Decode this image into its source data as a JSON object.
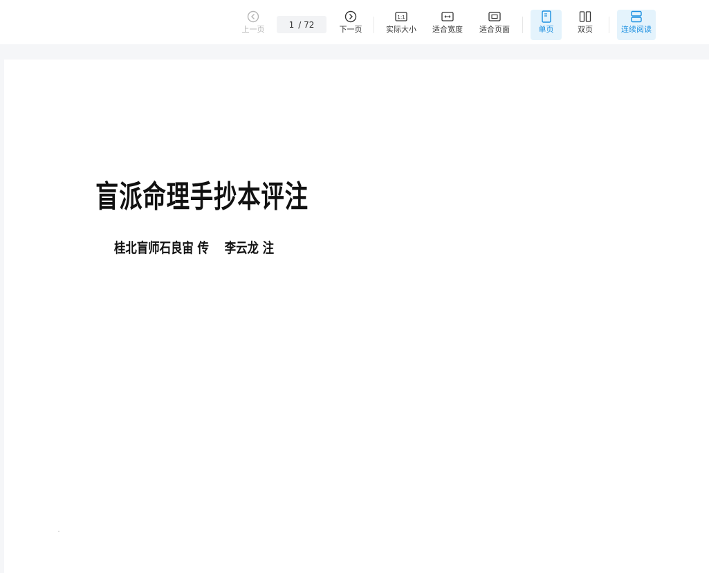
{
  "toolbar": {
    "prev_label": "上一页",
    "current_page": "1",
    "total_pages": "/ 72",
    "next_label": "下一页",
    "actual_size_label": "实际大小",
    "actual_size_icon_text": "1:1",
    "fit_width_label": "适合宽度",
    "fit_page_label": "适合页面",
    "single_page_label": "单页",
    "double_page_label": "双页",
    "continuous_label": "连续阅读",
    "active_color": "#1a8fe0",
    "icons": [
      "chevron-left-circle-icon",
      "chevron-right-circle-icon",
      "actual-size-icon",
      "fit-width-icon",
      "fit-page-icon",
      "single-page-icon",
      "double-page-icon",
      "continuous-read-icon"
    ]
  },
  "document": {
    "title": "盲派命理手抄本评注",
    "subtitle": "桂北盲师石良宙 传    李云龙 注"
  }
}
